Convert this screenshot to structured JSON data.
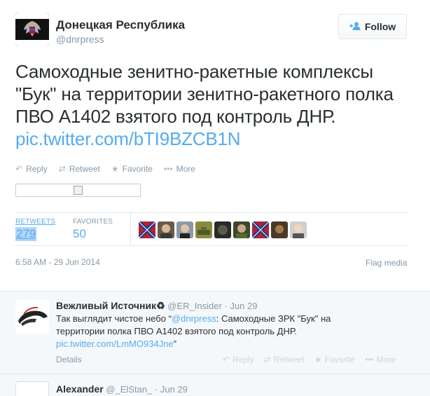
{
  "tweet": {
    "author_name": "Донецкая Республика",
    "author_handle": "@dnrpress",
    "avatar_text_top": "ДОНЕЦКАЯ",
    "avatar_text_bottom": "ПУБЛИКА",
    "follow_label": "Follow",
    "text": "Самоходные зенитно-ракетные комплексы \"Бук\" на территории зенитно-ракетного полка ПВО А1402 взятого под контроль ДНР.",
    "link": "pic.twitter.com/bTI9BZCB1N",
    "actions": [
      {
        "label": "Reply",
        "icon": "reply-icon",
        "glyph": "↶"
      },
      {
        "label": "Retweet",
        "icon": "retweet-icon",
        "glyph": "⇄"
      },
      {
        "label": "Favorite",
        "icon": "star-icon",
        "glyph": "★"
      },
      {
        "label": "More",
        "icon": "more-icon",
        "glyph": "•••"
      }
    ],
    "stats": {
      "retweets_label": "RETWEETS",
      "retweets_count": "279",
      "favorites_label": "FAVORITES",
      "favorites_count": "50"
    },
    "timestamp": "6:58 AM - 29 Jun 2014",
    "flag_label": "Flag media"
  },
  "replies": [
    {
      "name": "Вежливый Источник♻",
      "handle": "@ER_Insider",
      "date": "Jun 29",
      "text_before": "Так выглядит чистое небо “",
      "mention": "@dnrpress",
      "text_after": ": Самоходные ЗРК \"Бук\" на территории полка ПВО А1402 взятого под контроль ДНР.",
      "link": "pic.twitter.com/LmMO934Jne",
      "text_end": "”",
      "details_label": "Details",
      "actions": [
        "Reply",
        "Retweet",
        "Favorite",
        "More"
      ]
    },
    {
      "name": "Alexander",
      "handle": "@_ElStan_",
      "date": "Jun 29"
    }
  ],
  "colors": {
    "link": "#55acee",
    "muted": "#8899a6",
    "text": "#292f33",
    "reply_bg": "#f5f8fa"
  }
}
